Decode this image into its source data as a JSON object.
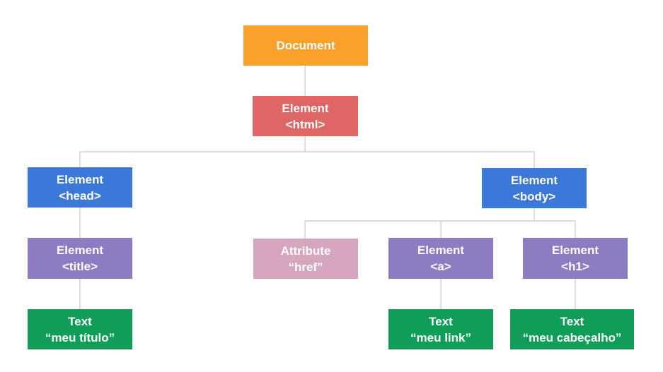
{
  "nodes": {
    "document": {
      "line1": "Document",
      "line2": ""
    },
    "html": {
      "line1": "Element",
      "line2": "<html>"
    },
    "head": {
      "line1": "Element",
      "line2": "<head>"
    },
    "body": {
      "line1": "Element",
      "line2": "<body>"
    },
    "title": {
      "line1": "Element",
      "line2": "<title>"
    },
    "attr_href": {
      "line1": "Attribute",
      "line2": "“href”"
    },
    "a": {
      "line1": "Element",
      "line2": "<a>"
    },
    "h1": {
      "line1": "Element",
      "line2": "<h1>"
    },
    "text_title": {
      "line1": "Text",
      "line2": "“meu título”"
    },
    "text_link": {
      "line1": "Text",
      "line2": "“meu link”"
    },
    "text_h1": {
      "line1": "Text",
      "line2": "“meu cabeçalho”"
    }
  },
  "colors": {
    "document": "#f9a12a",
    "html": "#e06666",
    "element": "#3b78d8",
    "leaf_element": "#8e7cc3",
    "attribute": "#d5a6bd",
    "text": "#0f9d58",
    "connector": "#c8c8c8"
  }
}
